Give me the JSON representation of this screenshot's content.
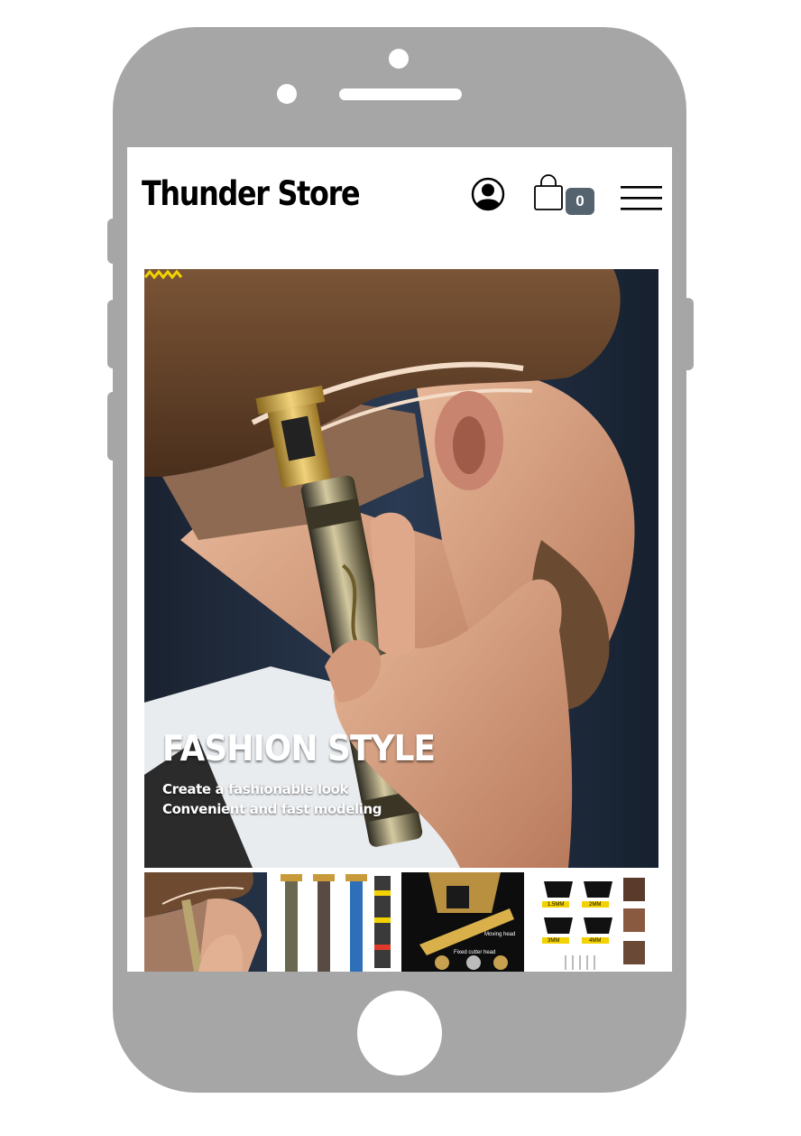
{
  "header": {
    "brand": "Thunder Store",
    "cart_count": "0",
    "icons": [
      "account-icon",
      "shopping-bag-icon",
      "menu-icon"
    ]
  },
  "hero": {
    "title": "FASHION STYLE",
    "subtitle_line1": "Create a fashionable look",
    "subtitle_line2": "Convenient and fast modeling",
    "accent_color": "#f2d200"
  },
  "thumbnails": {
    "items": [
      {
        "name": "haircut-trimmer"
      },
      {
        "name": "trimmer-variants"
      },
      {
        "name": "trimmer-head-detail",
        "labels": [
          "Moving head",
          "Fixed cutter head"
        ]
      },
      {
        "name": "guide-combs",
        "labels": [
          "1.5MM",
          "2MM",
          "3MM",
          "4MM"
        ]
      }
    ]
  },
  "colors": {
    "phone_frame": "#a6a6a6",
    "badge": "#55636f"
  }
}
